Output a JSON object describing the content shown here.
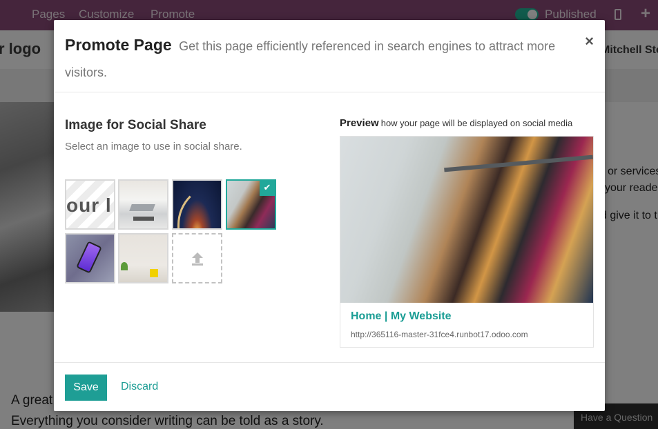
{
  "topbar": {
    "menu": [
      "Pages",
      "Customize",
      "Promote"
    ],
    "published_label": "Published"
  },
  "site": {
    "logo_text": "r logo",
    "user_name": "Mitchell Ste",
    "right_text": [
      "or services",
      "your reader",
      "d give it to t"
    ],
    "bottom_line1": "A great",
    "bottom_line2": "Everything you consider writing can be told as a story.",
    "question_button": "Have a Question"
  },
  "modal": {
    "title": "Promote Page",
    "subtitle": "Get this page efficiently referenced in search engines to attract more visitors.",
    "close": "×",
    "section_title": "Image for Social Share",
    "section_desc": "Select an image to use in social share.",
    "thumbnails": [
      {
        "name": "logo",
        "text": "our l",
        "selected": false
      },
      {
        "name": "desk",
        "selected": false
      },
      {
        "name": "rocket",
        "selected": false
      },
      {
        "name": "clothes",
        "selected": true
      },
      {
        "name": "phone",
        "selected": false
      },
      {
        "name": "plant",
        "selected": false
      }
    ],
    "preview_label": "Preview",
    "preview_hint": "how your page will be displayed on social media",
    "card_title": "Home | My Website",
    "card_url": "http://365116-master-31fce4.runbot17.odoo.com",
    "save_label": "Save",
    "discard_label": "Discard"
  },
  "colors": {
    "topbar": "#8b4a79",
    "accent": "#1e9e95",
    "toggle_on": "#21b799"
  }
}
